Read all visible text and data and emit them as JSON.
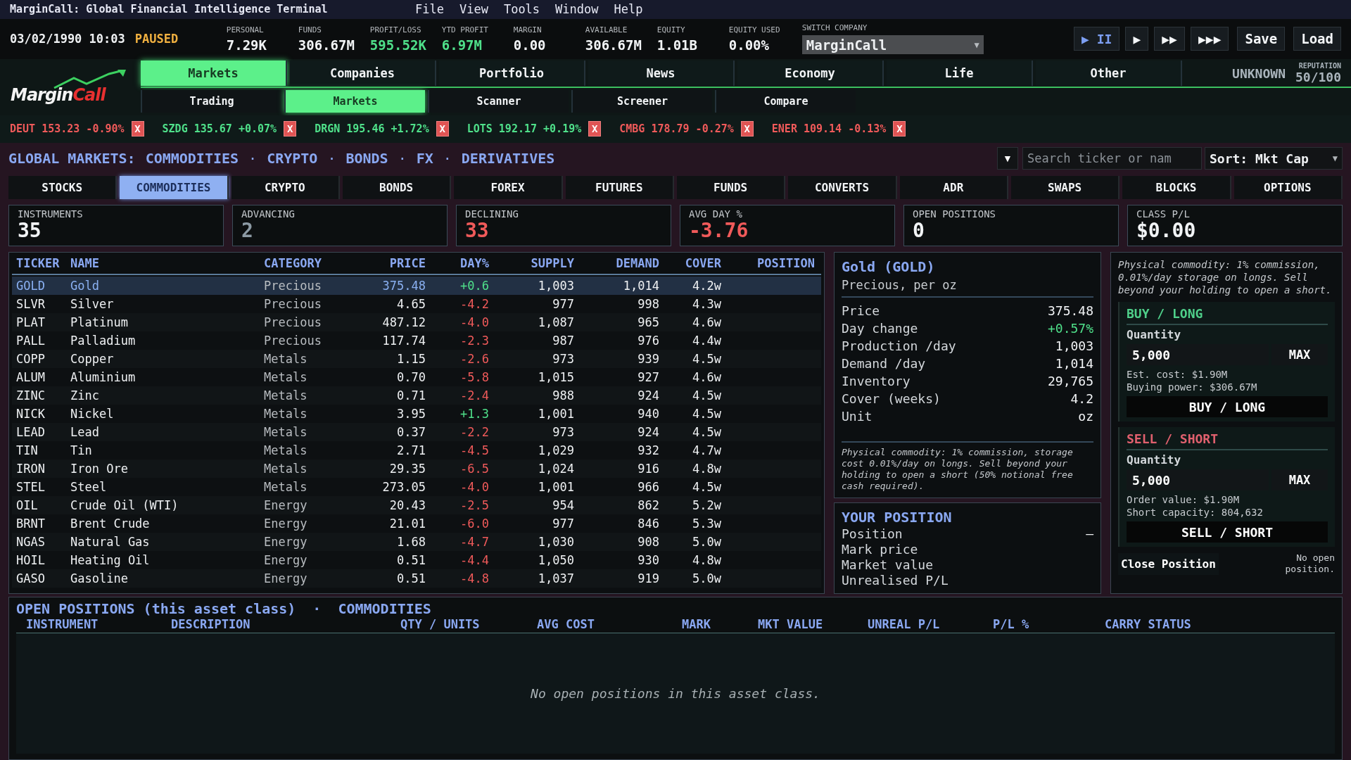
{
  "window": {
    "title": "MarginCall: Global Financial Intelligence Terminal"
  },
  "menu": [
    "File",
    "View",
    "Tools",
    "Window",
    "Help"
  ],
  "clock": {
    "date": "03/02/1990 10:03",
    "state": "PAUSED"
  },
  "stats": [
    {
      "label": "PERSONAL",
      "value": "7.29K",
      "color": "#f2f4f6"
    },
    {
      "label": "FUNDS",
      "value": "306.67M",
      "color": "#f2f4f6"
    },
    {
      "label": "PROFIT/LOSS",
      "value": "595.52K",
      "color": "#4fe08a"
    },
    {
      "label": "YTD PROFIT",
      "value": "6.97M",
      "color": "#4fe08a"
    },
    {
      "label": "MARGIN",
      "value": "0.00",
      "color": "#f2f4f6"
    },
    {
      "label": "AVAILABLE",
      "value": "306.67M",
      "color": "#f2f4f6"
    },
    {
      "label": "EQUITY",
      "value": "1.01B",
      "color": "#f2f4f6"
    },
    {
      "label": "EQUITY USED",
      "value": "0.00%",
      "color": "#f2f4f6"
    }
  ],
  "company_switch": {
    "label": "SWITCH COMPANY",
    "value": "MarginCall",
    "caret": "▼"
  },
  "speed_controls": [
    {
      "label": "▶ II",
      "selected": true
    },
    {
      "label": "▶",
      "selected": false
    },
    {
      "label": "▶▶",
      "selected": false
    },
    {
      "label": "▶▶▶",
      "selected": false
    }
  ],
  "file_buttons": [
    "Save",
    "Load"
  ],
  "logo": {
    "first": "Margin",
    "second": "Call"
  },
  "main_tabs": [
    {
      "label": "Markets",
      "selected": true
    },
    {
      "label": "Companies",
      "selected": false
    },
    {
      "label": "Portfolio",
      "selected": false
    },
    {
      "label": "News",
      "selected": false
    },
    {
      "label": "Economy",
      "selected": false
    },
    {
      "label": "Life",
      "selected": false
    },
    {
      "label": "Other",
      "selected": false
    }
  ],
  "reputation": {
    "status": "UNKNOWN",
    "label": "REPUTATION",
    "value": "50/100"
  },
  "sub_tabs": [
    {
      "label": "Trading",
      "selected": false
    },
    {
      "label": "Markets",
      "selected": true
    },
    {
      "label": "Scanner",
      "selected": false
    },
    {
      "label": "Screener",
      "selected": false
    },
    {
      "label": "Compare",
      "selected": false
    }
  ],
  "tickers": [
    {
      "text": "DEUT 153.23 -0.90%",
      "color": "#f05a5a",
      "close": "X"
    },
    {
      "text": "SZDG 135.67 +0.07%",
      "color": "#4fe08a",
      "close": "X"
    },
    {
      "text": "DRGN 195.46 +1.72%",
      "color": "#4fe08a",
      "close": "X"
    },
    {
      "text": "LOTS 192.17 +0.19%",
      "color": "#4fe08a",
      "close": "X"
    },
    {
      "text": "CMBG 178.79 -0.27%",
      "color": "#f05a5a",
      "close": "X"
    },
    {
      "text": "ENER 109.14 -0.13%",
      "color": "#f05a5a",
      "close": "X"
    }
  ],
  "market_header": {
    "title": "GLOBAL MARKETS:",
    "items": [
      {
        "kind": "link",
        "text": "COMMODITIES"
      },
      {
        "kind": "separator",
        "text": "·"
      },
      {
        "kind": "link",
        "text": "CRYPTO"
      },
      {
        "kind": "separator",
        "text": "·"
      },
      {
        "kind": "link",
        "text": "BONDS"
      },
      {
        "kind": "separator",
        "text": "·"
      },
      {
        "kind": "link",
        "text": "FX"
      },
      {
        "kind": "separator",
        "text": "·"
      },
      {
        "kind": "link",
        "text": "DERIVATIVES"
      }
    ]
  },
  "filter_button": "▼",
  "search": {
    "placeholder": "Search ticker or nam"
  },
  "sort": {
    "value": "Sort: Mkt Cap",
    "caret": "▼"
  },
  "asset_tabs": [
    {
      "label": "STOCKS",
      "selected": false
    },
    {
      "label": "COMMODITIES",
      "selected": true
    },
    {
      "label": "CRYPTO",
      "selected": false
    },
    {
      "label": "BONDS",
      "selected": false
    },
    {
      "label": "FOREX",
      "selected": false
    },
    {
      "label": "FUTURES",
      "selected": false
    },
    {
      "label": "FUNDS",
      "selected": false
    },
    {
      "label": "CONVERTS",
      "selected": false
    },
    {
      "label": "ADR",
      "selected": false
    },
    {
      "label": "SWAPS",
      "selected": false
    },
    {
      "label": "BLOCKS",
      "selected": false
    },
    {
      "label": "OPTIONS",
      "selected": false
    }
  ],
  "summary_cards": [
    {
      "label": "INSTRUMENTS",
      "value": "35",
      "color": "#f2f4f6"
    },
    {
      "label": "ADVANCING",
      "value": "2",
      "color": "#8c9aa4"
    },
    {
      "label": "DECLINING",
      "value": "33",
      "color": "#f05a5a"
    },
    {
      "label": "AVG DAY %",
      "value": "-3.76",
      "color": "#f05a5a"
    },
    {
      "label": "OPEN POSITIONS",
      "value": "0",
      "color": "#f2f4f6"
    },
    {
      "label": "CLASS P/L",
      "value": "$0.00",
      "color": "#f2f4f6"
    }
  ],
  "table": {
    "columns": [
      "TICKER",
      "NAME",
      "CATEGORY",
      "PRICE",
      "DAY%",
      "SUPPLY",
      "DEMAND",
      "COVER",
      "POSITION"
    ],
    "rows": [
      {
        "ticker": "GOLD",
        "name": "Gold",
        "category": "Precious",
        "price": "375.48",
        "day": "+0.6",
        "color": "#4fe08a",
        "supply": "1,003",
        "demand": "1,014",
        "cover": "4.2w",
        "selected": true
      },
      {
        "ticker": "SLVR",
        "name": "Silver",
        "category": "Precious",
        "price": "4.65",
        "day": "-4.2",
        "color": "#f05a5a",
        "supply": "977",
        "demand": "998",
        "cover": "4.3w",
        "selected": false
      },
      {
        "ticker": "PLAT",
        "name": "Platinum",
        "category": "Precious",
        "price": "487.12",
        "day": "-4.0",
        "color": "#f05a5a",
        "supply": "1,087",
        "demand": "965",
        "cover": "4.6w",
        "selected": false
      },
      {
        "ticker": "PALL",
        "name": "Palladium",
        "category": "Precious",
        "price": "117.74",
        "day": "-2.3",
        "color": "#f05a5a",
        "supply": "987",
        "demand": "976",
        "cover": "4.4w",
        "selected": false
      },
      {
        "ticker": "COPP",
        "name": "Copper",
        "category": "Metals",
        "price": "1.15",
        "day": "-2.6",
        "color": "#f05a5a",
        "supply": "973",
        "demand": "939",
        "cover": "4.5w",
        "selected": false
      },
      {
        "ticker": "ALUM",
        "name": "Aluminium",
        "category": "Metals",
        "price": "0.70",
        "day": "-5.8",
        "color": "#f05a5a",
        "supply": "1,015",
        "demand": "927",
        "cover": "4.6w",
        "selected": false
      },
      {
        "ticker": "ZINC",
        "name": "Zinc",
        "category": "Metals",
        "price": "0.71",
        "day": "-2.4",
        "color": "#f05a5a",
        "supply": "988",
        "demand": "924",
        "cover": "4.5w",
        "selected": false
      },
      {
        "ticker": "NICK",
        "name": "Nickel",
        "category": "Metals",
        "price": "3.95",
        "day": "+1.3",
        "color": "#4fe08a",
        "supply": "1,001",
        "demand": "940",
        "cover": "4.5w",
        "selected": false
      },
      {
        "ticker": "LEAD",
        "name": "Lead",
        "category": "Metals",
        "price": "0.37",
        "day": "-2.2",
        "color": "#f05a5a",
        "supply": "973",
        "demand": "924",
        "cover": "4.5w",
        "selected": false
      },
      {
        "ticker": "TIN",
        "name": "Tin",
        "category": "Metals",
        "price": "2.71",
        "day": "-4.5",
        "color": "#f05a5a",
        "supply": "1,029",
        "demand": "932",
        "cover": "4.7w",
        "selected": false
      },
      {
        "ticker": "IRON",
        "name": "Iron Ore",
        "category": "Metals",
        "price": "29.35",
        "day": "-6.5",
        "color": "#f05a5a",
        "supply": "1,024",
        "demand": "916",
        "cover": "4.8w",
        "selected": false
      },
      {
        "ticker": "STEL",
        "name": "Steel",
        "category": "Metals",
        "price": "273.05",
        "day": "-4.0",
        "color": "#f05a5a",
        "supply": "1,001",
        "demand": "966",
        "cover": "4.5w",
        "selected": false
      },
      {
        "ticker": "OIL",
        "name": "Crude Oil (WTI)",
        "category": "Energy",
        "price": "20.43",
        "day": "-2.5",
        "color": "#f05a5a",
        "supply": "954",
        "demand": "862",
        "cover": "5.2w",
        "selected": false
      },
      {
        "ticker": "BRNT",
        "name": "Brent Crude",
        "category": "Energy",
        "price": "21.01",
        "day": "-6.0",
        "color": "#f05a5a",
        "supply": "977",
        "demand": "846",
        "cover": "5.3w",
        "selected": false
      },
      {
        "ticker": "NGAS",
        "name": "Natural Gas",
        "category": "Energy",
        "price": "1.68",
        "day": "-4.7",
        "color": "#f05a5a",
        "supply": "1,030",
        "demand": "908",
        "cover": "5.0w",
        "selected": false
      },
      {
        "ticker": "HOIL",
        "name": "Heating Oil",
        "category": "Energy",
        "price": "0.51",
        "day": "-4.4",
        "color": "#f05a5a",
        "supply": "1,050",
        "demand": "930",
        "cover": "4.8w",
        "selected": false
      },
      {
        "ticker": "GASO",
        "name": "Gasoline",
        "category": "Energy",
        "price": "0.51",
        "day": "-4.8",
        "color": "#f05a5a",
        "supply": "1,037",
        "demand": "919",
        "cover": "5.0w",
        "selected": false
      }
    ]
  },
  "detail": {
    "title": "Gold (GOLD)",
    "subtitle": "Precious, per oz",
    "fields": [
      {
        "label": "Price",
        "value": "375.48",
        "color": "#f2f4f6"
      },
      {
        "label": "Day change",
        "value": "+0.57%",
        "color": "#4fe08a"
      },
      {
        "label": "Production /day",
        "value": "1,003",
        "color": "#f2f4f6"
      },
      {
        "label": "Demand /day",
        "value": "1,014",
        "color": "#f2f4f6"
      },
      {
        "label": "Inventory",
        "value": "29,765",
        "color": "#f2f4f6"
      },
      {
        "label": "Cover (weeks)",
        "value": "4.2",
        "color": "#f2f4f6"
      },
      {
        "label": "Unit",
        "value": "oz",
        "color": "#f2f4f6"
      }
    ],
    "note": "Physical commodity: 1% commission, storage cost 0.01%/day on longs. Sell beyond your holding to open a short (50% notional free cash required)."
  },
  "position": {
    "title": "YOUR POSITION",
    "fields": [
      {
        "label": "Position",
        "value": "–"
      },
      {
        "label": "Mark price"
      },
      {
        "label": "Market value"
      },
      {
        "label": "Unrealised P/L"
      }
    ]
  },
  "trade": {
    "note": "Physical commodity: 1% commission, 0.01%/day storage on longs. Sell beyond your holding to open a short.",
    "sections": [
      {
        "kind": "buy",
        "title": "BUY / LONG",
        "quantity_label": "Quantity",
        "quantity": "5,000",
        "max": "MAX",
        "info": [
          "Est. cost: $1.90M",
          "Buying power: $306.67M"
        ],
        "action": "BUY / LONG"
      },
      {
        "kind": "sell",
        "title": "SELL / SHORT",
        "quantity_label": "Quantity",
        "quantity": "5,000",
        "max": "MAX",
        "info": [
          "Order value: $1.90M",
          "Short capacity: 804,632"
        ],
        "action": "SELL / SHORT"
      }
    ],
    "close": "Close Position",
    "close_note": "No open position."
  },
  "positions_panel": {
    "title": "OPEN POSITIONS (this asset class)",
    "separator": "·",
    "asset_class": "COMMODITIES",
    "columns": [
      "INSTRUMENT",
      "DESCRIPTION",
      "QTY / UNITS",
      "AVG COST",
      "MARK",
      "MKT VALUE",
      "UNREAL P/L",
      "P/L %",
      "CARRY STATUS"
    ],
    "empty": "No open positions in this asset class."
  }
}
